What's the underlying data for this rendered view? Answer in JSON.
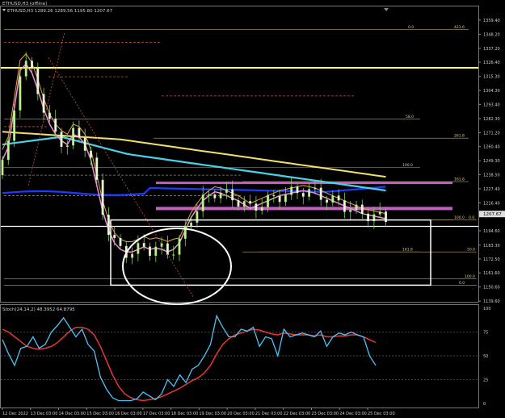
{
  "chart_data": {
    "type": "line",
    "window_title": "ETHUSD,H3 (offline)",
    "ohlc_header": "ETHUSD,H3  1289.26 1289.56 1195.80 1207.67",
    "current_price_label": "1207.67",
    "price_axis": {
      "min": 1139.0,
      "max": 1370.0,
      "ticks": [
        "1359.40",
        "1348.20",
        "1337.20",
        "1326.40",
        "1315.30",
        "1304.30",
        "1293.40",
        "1282.30",
        "1271.20",
        "1260.40",
        "1249.30",
        "1238.50",
        "1227.40",
        "1216.40",
        "1194.60",
        "1183.30",
        "1172.50",
        "1161.60",
        "1150.60",
        "1139.60"
      ]
    },
    "time_axis": {
      "ticks": [
        "12 Dec 2022",
        "13 Dec 03:00",
        "14 Dec 03:00",
        "15 Dec 03:00",
        "16 Dec 03:00",
        "17 Dec 03:00",
        "18 Dec 03:00",
        "19 Dec 03:00",
        "20 Dec 03:00",
        "21 Dec 03:00",
        "22 Dec 03:00",
        "23 Dec 03:00",
        "24 Dec 03:00",
        "25 Dec 03:00"
      ]
    },
    "fib_levels": [
      {
        "label": "0.0",
        "value": "423.6",
        "price": 1352
      },
      {
        "label": "58.0",
        "price": 1282
      },
      {
        "label": "261.8",
        "price": 1267
      },
      {
        "label": "100.0",
        "price": 1244
      },
      {
        "label": "161.8",
        "price": 1233
      },
      {
        "label": "100.0",
        "price": 1203
      },
      {
        "label": "0.0",
        "price": 1203
      },
      {
        "label": "161.8",
        "price": 1178
      },
      {
        "label": "50.0",
        "price": 1178
      },
      {
        "label": "100.0",
        "price": 1157
      },
      {
        "label": "0.0",
        "price": 1152
      }
    ],
    "horizontal_lines": [
      {
        "price": 1322,
        "color": "#ffff55"
      },
      {
        "price": 1198,
        "color": "#ffffff"
      }
    ],
    "stochastic": {
      "label": "Stoch(24,14,2) 48.3952 64.8795",
      "range": [
        0,
        100
      ],
      "ticks": [
        "100",
        "75",
        "50",
        "25",
        "0"
      ],
      "main_color": "#4fc3f7",
      "signal_color": "#e53935",
      "main_values": [
        67,
        52,
        40,
        58,
        60,
        70,
        58,
        62,
        75,
        82,
        90,
        80,
        70,
        78,
        62,
        55,
        28,
        15,
        6,
        3,
        3,
        3,
        5,
        12,
        8,
        4,
        10,
        25,
        18,
        30,
        22,
        36,
        40,
        50,
        62,
        92,
        80,
        70,
        70,
        78,
        76,
        80,
        60,
        70,
        68,
        50,
        78,
        70,
        72,
        74,
        72,
        70,
        76,
        60,
        70,
        74,
        72,
        75,
        72,
        70,
        50,
        40
      ],
      "signal_values": [
        78,
        75,
        70,
        65,
        60,
        58,
        57,
        58,
        60,
        64,
        70,
        76,
        80,
        80,
        78,
        72,
        60,
        45,
        30,
        18,
        10,
        6,
        4,
        3,
        4,
        5,
        7,
        10,
        13,
        16,
        20,
        24,
        27,
        32,
        40,
        52,
        62,
        68,
        72,
        74,
        76,
        78,
        77,
        75,
        73,
        72,
        74,
        73,
        72,
        72,
        72,
        71,
        72,
        70,
        70,
        71,
        71,
        72,
        72,
        70,
        67,
        64
      ]
    }
  }
}
